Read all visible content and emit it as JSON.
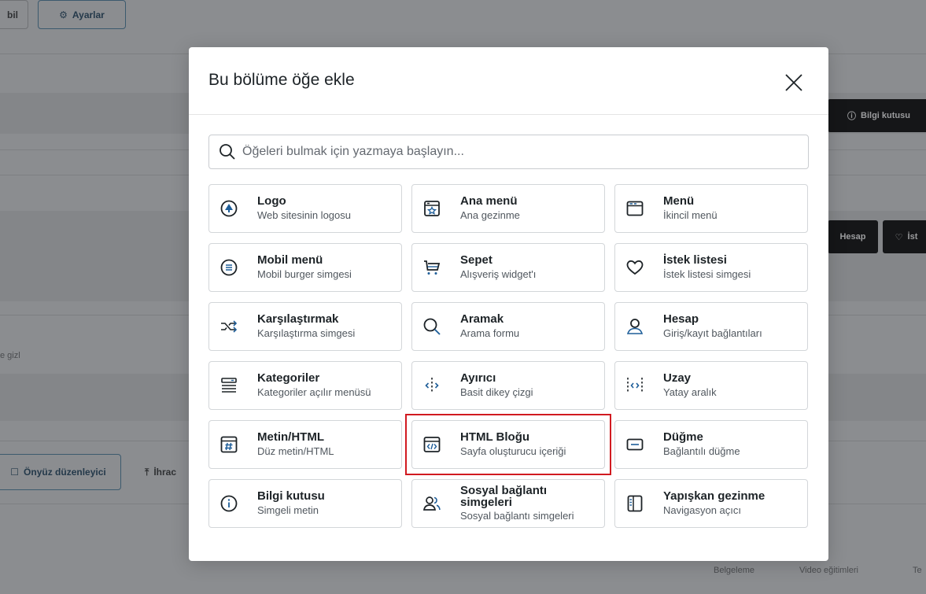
{
  "background": {
    "top_buttons": [
      "bil",
      "Ayarlar"
    ],
    "right_dark_button": "Bilgi kutusu",
    "right_small_buttons": [
      "Hesap",
      "İst"
    ],
    "side_text": "e gizl",
    "bottom_buttons": [
      "Önyüz düzenleyici",
      "İhrac"
    ],
    "footer_links": [
      "Belgeleme",
      "Video eğitimleri",
      "Te"
    ]
  },
  "modal": {
    "title": "Bu bölüme öğe ekle",
    "search_placeholder": "Öğeleri bulmak için yazmaya başlayın...",
    "items": [
      {
        "title": "Logo",
        "desc": "Web sitesinin logosu",
        "icon": "logo-icon"
      },
      {
        "title": "Ana menü",
        "desc": "Ana gezinme",
        "icon": "main-menu-icon"
      },
      {
        "title": "Menü",
        "desc": "İkincil menü",
        "icon": "menu-icon"
      },
      {
        "title": "Mobil menü",
        "desc": "Mobil burger simgesi",
        "icon": "mobile-menu-icon"
      },
      {
        "title": "Sepet",
        "desc": "Alışveriş widget'ı",
        "icon": "cart-icon"
      },
      {
        "title": "İstek listesi",
        "desc": "İstek listesi simgesi",
        "icon": "heart-icon"
      },
      {
        "title": "Karşılaştırmak",
        "desc": "Karşılaştırma simgesi",
        "icon": "compare-icon"
      },
      {
        "title": "Aramak",
        "desc": "Arama formu",
        "icon": "search-icon"
      },
      {
        "title": "Hesap",
        "desc": "Giriş/kayıt bağlantıları",
        "icon": "account-icon"
      },
      {
        "title": "Kategoriler",
        "desc": "Kategoriler açılır menüsü",
        "icon": "categories-icon"
      },
      {
        "title": "Ayırıcı",
        "desc": "Basit dikey çizgi",
        "icon": "divider-icon"
      },
      {
        "title": "Uzay",
        "desc": "Yatay aralık",
        "icon": "space-icon"
      },
      {
        "title": "Metin/HTML",
        "desc": "Düz metin/HTML",
        "icon": "text-html-icon"
      },
      {
        "title": "HTML Bloğu",
        "desc": "Sayfa oluşturucu içeriği",
        "icon": "html-block-icon"
      },
      {
        "title": "Düğme",
        "desc": "Bağlantılı düğme",
        "icon": "button-icon"
      },
      {
        "title": "Bilgi kutusu",
        "desc": "Simgeli metin",
        "icon": "info-icon"
      },
      {
        "title": "Sosyal bağlantı simgeleri",
        "desc": "Sosyal bağlantı simgeleri",
        "icon": "social-icon"
      },
      {
        "title": "Yapışkan gezinme",
        "desc": "Navigasyon açıcı",
        "icon": "sticky-nav-icon"
      }
    ]
  },
  "colors": {
    "icon": "#1e5e99",
    "highlight": "#d11a20"
  }
}
